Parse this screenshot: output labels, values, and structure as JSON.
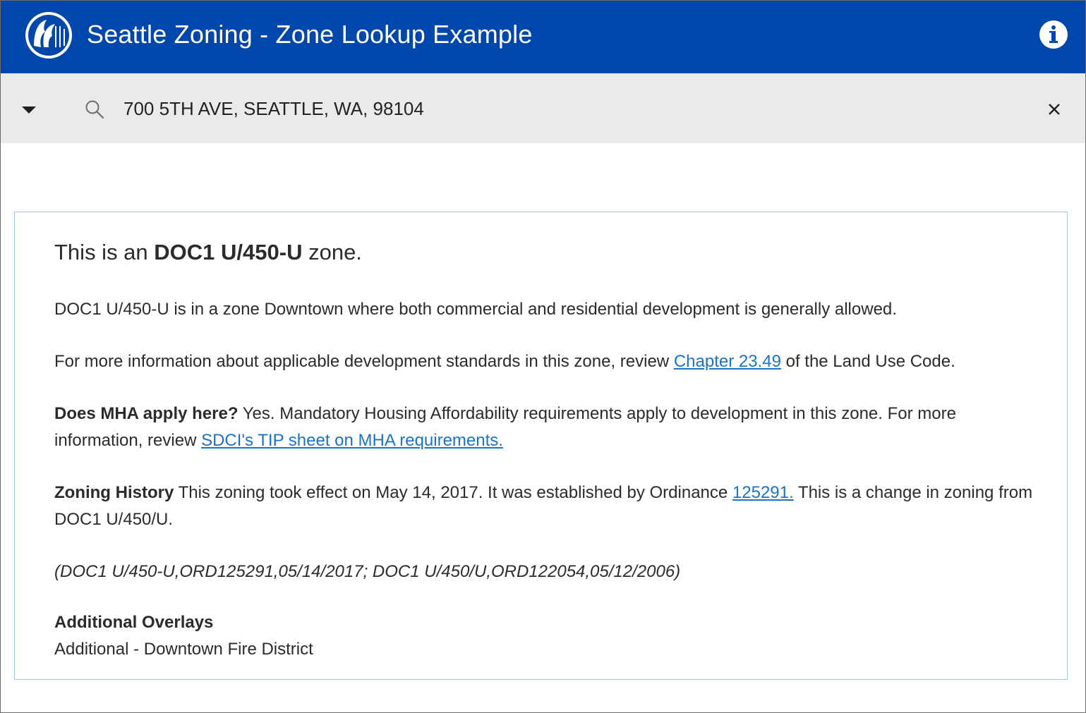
{
  "header": {
    "title": "Seattle Zoning - Zone Lookup Example",
    "logo_icon": "seattle-seal-icon",
    "info_icon": "info-icon",
    "background_color": "#0047ab"
  },
  "search": {
    "value": "700 5TH AVE, SEATTLE, WA, 98104",
    "dropdown_icon": "caret-down-icon",
    "search_icon": "search-icon",
    "clear_icon": "close-icon",
    "clear_glyph": "×"
  },
  "result": {
    "heading_prefix": "This is an ",
    "heading_zone": "DOC1 U/450-U",
    "heading_suffix": " zone.",
    "description": "DOC1 U/450-U is in a zone Downtown where both commercial and residential development is generally allowed.",
    "standards_prefix": "For more information about applicable development standards in this zone, review ",
    "standards_link": "Chapter 23.49",
    "standards_suffix": " of the Land Use Code.",
    "mha_label": "Does MHA apply here?",
    "mha_text": " Yes. Mandatory Housing Affordability requirements apply to development in this zone. For more information, review ",
    "mha_link": "SDCI's TIP sheet on MHA requirements.",
    "history_label": "Zoning History",
    "history_text": " This zoning took effect on May 14, 2017. It was established by Ordinance ",
    "history_link": "125291.",
    "history_suffix": " This is a change in zoning from DOC1 U/450/U.",
    "history_codes": "(DOC1 U/450-U,ORD125291,05/14/2017; DOC1 U/450/U,ORD122054,05/12/2006)",
    "overlays_title": "Additional Overlays",
    "overlays_value": "Additional - Downtown Fire District",
    "link_color": "#1a73c9",
    "border_color": "#9ec9e4"
  }
}
